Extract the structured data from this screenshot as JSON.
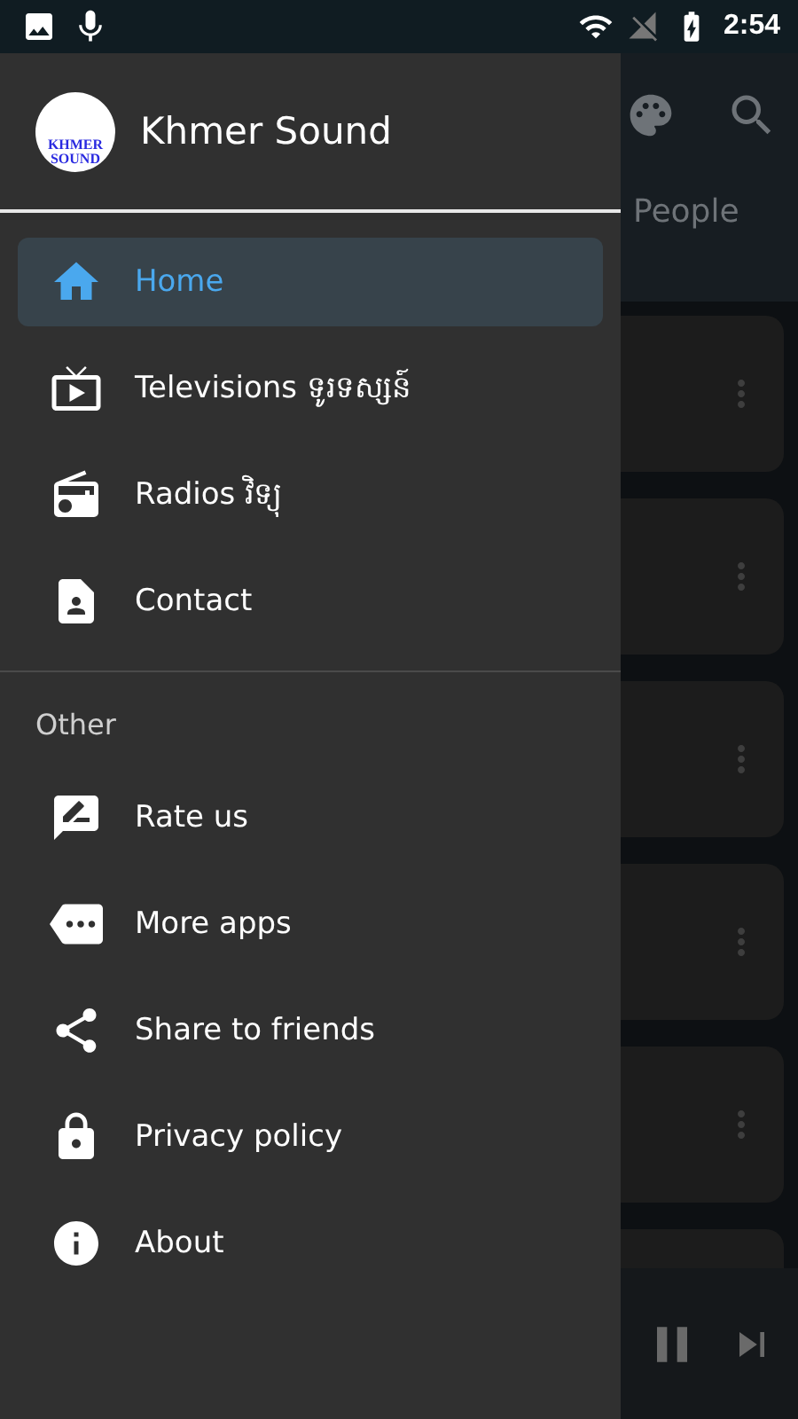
{
  "status_bar": {
    "time": "2:54"
  },
  "drawer": {
    "app_name": "Khmer Sound",
    "logo_lines": [
      "KHMER",
      "SOUND"
    ],
    "main_items": [
      {
        "label": "Home",
        "selected": true
      },
      {
        "label": "Televisions ទូរទស្សន៍",
        "selected": false
      },
      {
        "label": "Radios វិទ្យុ",
        "selected": false
      },
      {
        "label": "Contact",
        "selected": false
      }
    ],
    "section_title": "Other",
    "other_items": [
      {
        "label": "Rate us"
      },
      {
        "label": "More apps"
      },
      {
        "label": "Share to friends"
      },
      {
        "label": "Privacy policy"
      },
      {
        "label": "About"
      }
    ]
  },
  "background": {
    "tab_label": "People"
  }
}
